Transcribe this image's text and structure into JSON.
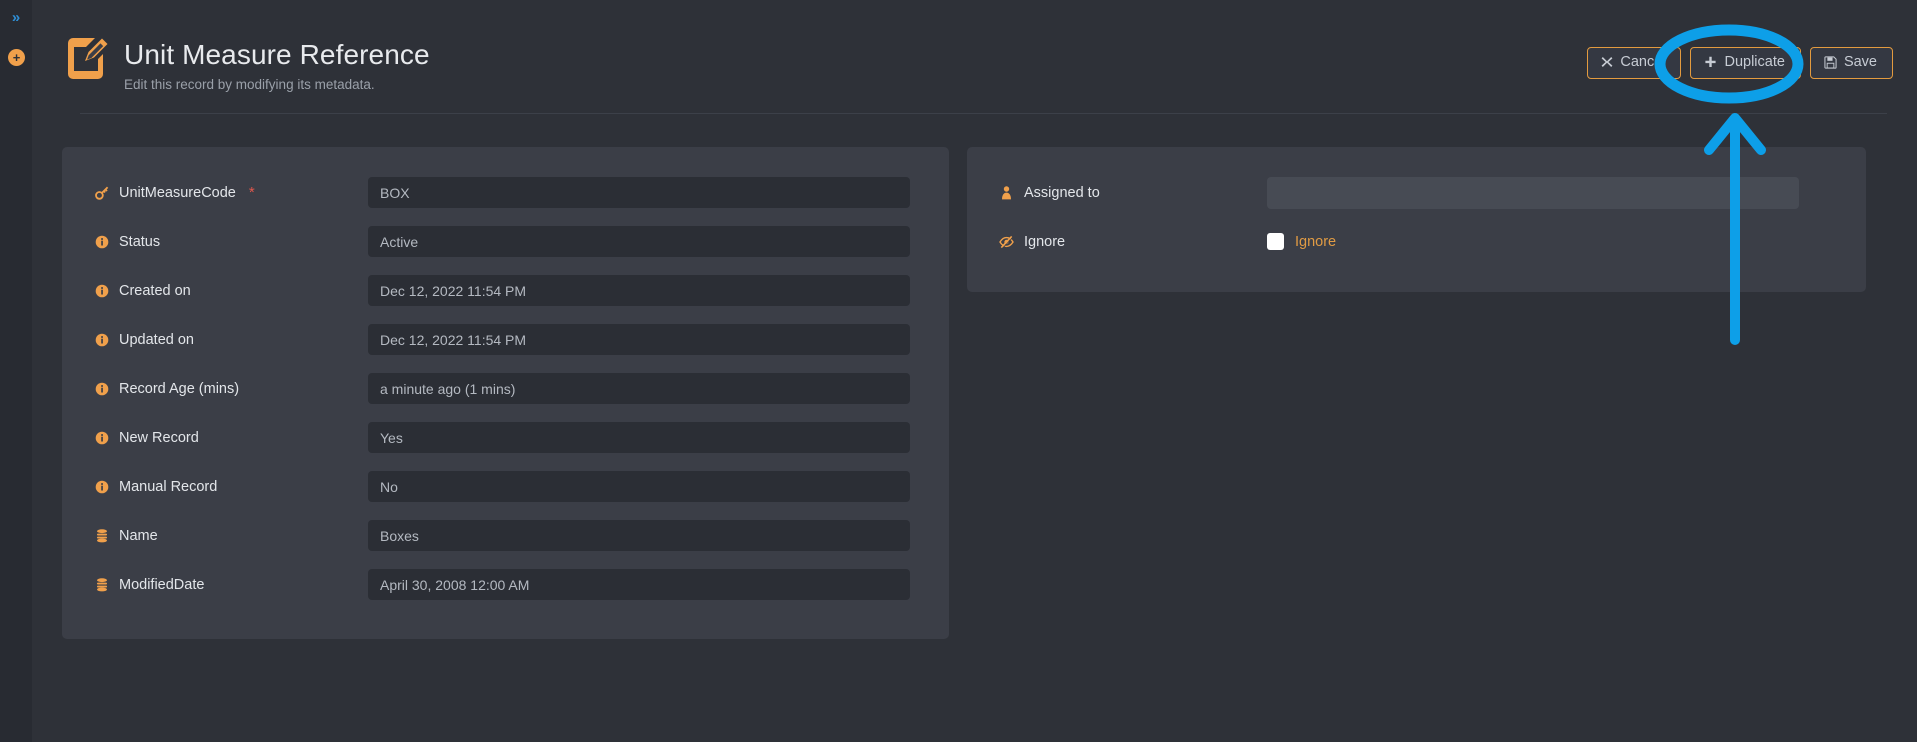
{
  "rail": {
    "expand_icon": "chevron-double-right-icon",
    "expand_glyph": "»",
    "add_icon": "plus-circle-icon",
    "add_glyph": "+"
  },
  "header": {
    "icon": "edit-record-icon",
    "title": "Unit Measure Reference",
    "subtitle": "Edit this record by modifying its metadata."
  },
  "toolbar": {
    "cancel_label": "Cancel",
    "cancel_icon": "close-x-icon",
    "duplicate_label": "Duplicate",
    "duplicate_icon": "plus-icon",
    "save_label": "Save",
    "save_icon": "floppy-disk-icon"
  },
  "left_panel": {
    "fields": [
      {
        "label": "UnitMeasureCode",
        "icon": "key-icon",
        "required": true,
        "value": "BOX"
      },
      {
        "label": "Status",
        "icon": "info-icon",
        "required": false,
        "value": "Active"
      },
      {
        "label": "Created on",
        "icon": "info-icon",
        "required": false,
        "value": "Dec 12, 2022 11:54 PM"
      },
      {
        "label": "Updated on",
        "icon": "info-icon",
        "required": false,
        "value": "Dec 12, 2022 11:54 PM"
      },
      {
        "label": "Record Age (mins)",
        "icon": "info-icon",
        "required": false,
        "value": "a minute ago (1 mins)"
      },
      {
        "label": "New Record",
        "icon": "info-icon",
        "required": false,
        "value": "Yes"
      },
      {
        "label": "Manual Record",
        "icon": "info-icon",
        "required": false,
        "value": "No"
      },
      {
        "label": "Name",
        "icon": "database-icon",
        "required": false,
        "value": "Boxes"
      },
      {
        "label": "ModifiedDate",
        "icon": "database-icon",
        "required": false,
        "value": "April 30, 2008 12:00 AM"
      }
    ]
  },
  "right_panel": {
    "assigned_to": {
      "label": "Assigned to",
      "icon": "user-icon",
      "value": ""
    },
    "ignore": {
      "label": "Ignore",
      "icon": "eye-slash-icon",
      "checkbox_label": "Ignore",
      "checked": false
    }
  },
  "annotation": {
    "highlight_target": "Duplicate",
    "color": "#0d9fe8"
  },
  "colors": {
    "background": "#2e3138",
    "card": "#3b3e47",
    "field": "#2b2e35",
    "accent": "#f0a04b",
    "required": "#e2574c",
    "annotation": "#0d9fe8"
  }
}
